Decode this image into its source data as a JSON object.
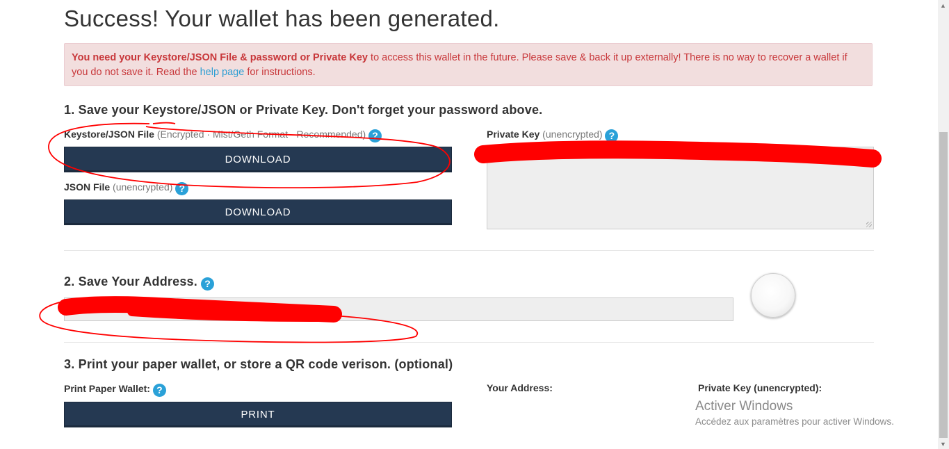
{
  "page_title": "Success! Your wallet has been generated.",
  "alert": {
    "bold_text": "You need your Keystore/JSON File & password or Private Key",
    "text_1": " to access this wallet in the future. Please save & back it up externally! There is no way to recover a wallet if you do not save it. Read the ",
    "link_text": "help page",
    "text_2": " for instructions."
  },
  "section1": {
    "heading": "1. Save your Keystore/JSON or Private Key. Don't forget your password above.",
    "keystore": {
      "label": "Keystore/JSON File",
      "note": " (Encrypted · Mist/Geth Format · Recommended)",
      "button": "DOWNLOAD"
    },
    "json": {
      "label": "JSON File",
      "note": " (unencrypted)",
      "button": "DOWNLOAD"
    },
    "private_key": {
      "label": "Private Key",
      "note": " (unencrypted)"
    }
  },
  "section2": {
    "heading": "2. Save Your Address."
  },
  "section3": {
    "heading": "3. Print your paper wallet, or store a QR code verison. (optional)",
    "print_label": "Print Paper Wallet:",
    "print_button": "PRINT",
    "your_address_label": "Your Address:",
    "private_key_label": "Private Key (unencrypted):"
  },
  "watermark": {
    "title": "Activer Windows",
    "subtitle": "Accédez aux paramètres pour activer Windows."
  },
  "icons": {
    "help": "?"
  },
  "colors": {
    "button_bg": "#253952",
    "alert_bg": "#f2dede",
    "alert_text": "#c8373a",
    "link": "#2f9fd3",
    "help_icon": "#2aa1d8",
    "annotation_red": "#ff0000"
  }
}
